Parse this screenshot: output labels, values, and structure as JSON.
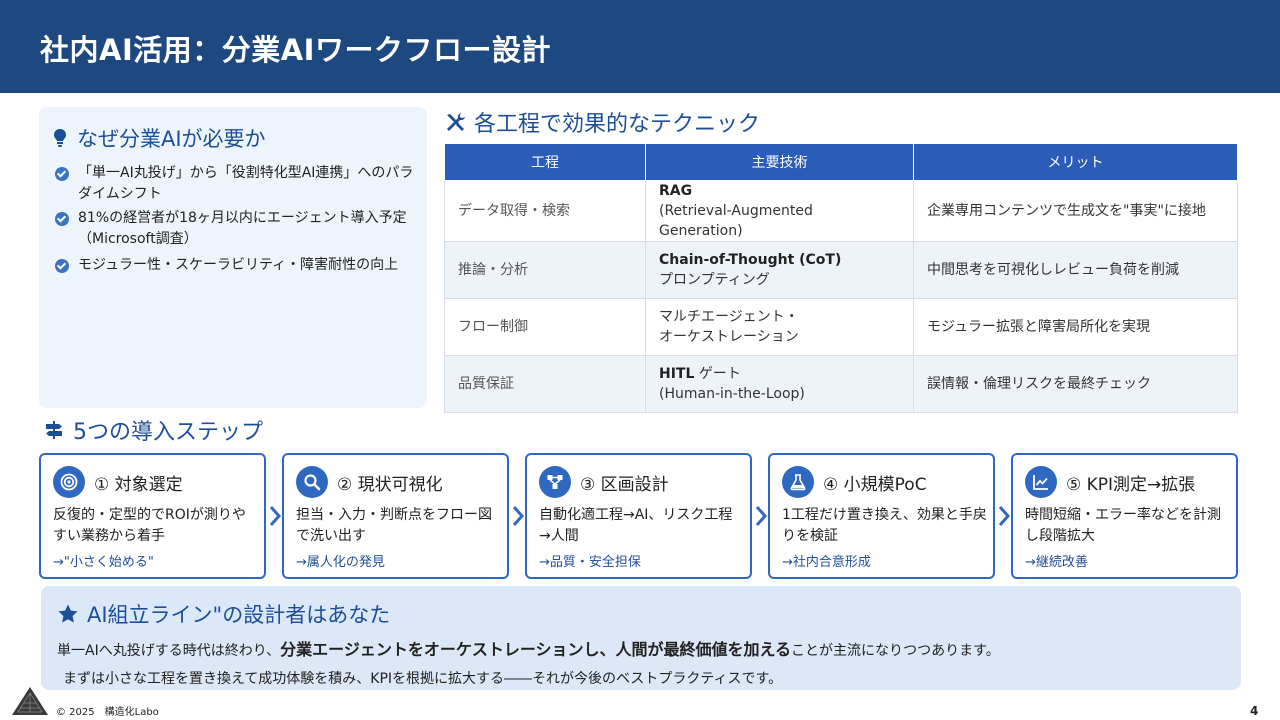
{
  "title": "社内AI活用：分業AIワークフロー設計",
  "why": {
    "title": "なぜ分業AIが必要か",
    "items": [
      "「単一AI丸投げ」から「役割特化型AI連携」へのパラダイムシフト",
      "81%の経営者が18ヶ月以内にエージェント導入予定（Microsoft調査）",
      "モジュラー性・スケーラビリティ・障害耐性の向上"
    ]
  },
  "techniques": {
    "title": "各工程で効果的なテクニック",
    "headers": [
      "工程",
      "主要技術",
      "メリット"
    ],
    "rows": [
      {
        "stage": "データ取得・検索",
        "tech_main": "RAG",
        "tech_sub": "(Retrieval-Augmented Generation)",
        "merit": "企業専用コンテンツで生成文を\"事実\"に接地"
      },
      {
        "stage": "推論・分析",
        "tech_main": "Chain-of-Thought (CoT)",
        "tech_sub": "プロンプティング",
        "merit": "中間思考を可視化しレビュー負荷を削減"
      },
      {
        "stage": "フロー制御",
        "tech_main": "マルチエージェント・",
        "tech_sub": "オーケストレーション",
        "merit": "モジュラー拡張と障害局所化を実現"
      },
      {
        "stage": "品質保証",
        "tech_main": "HITL",
        "tech_main_suffix": "ゲート",
        "tech_sub": "(Human-in-the-Loop)",
        "merit": "誤情報・倫理リスクを最終チェック"
      }
    ]
  },
  "steps": {
    "title": "5つの導入ステップ",
    "items": [
      {
        "name": "① 対象選定",
        "desc": "反復的・定型的でROIが測りやすい業務から着手",
        "result": "→\"小さく始める\"",
        "icon": "target-icon"
      },
      {
        "name": "② 現状可視化",
        "desc": "担当・入力・判断点をフロー図で洗い出す",
        "result": "→属人化の発見",
        "icon": "search-icon"
      },
      {
        "name": "③ 区画設計",
        "desc": "自動化適工程→AI、リスク工程→人間",
        "result": "→品質・安全担保",
        "icon": "network-icon"
      },
      {
        "name": "④ 小規模PoC",
        "desc": "1工程だけ置き換え、効果と手戻りを検証",
        "result": "→社内合意形成",
        "icon": "flask-icon"
      },
      {
        "name": "⑤ KPI測定→拡張",
        "desc": "時間短縮・エラー率などを計測し段階拡大",
        "result": "→継続改善",
        "icon": "chart-line-icon"
      }
    ]
  },
  "closing": {
    "title": "AI組立ライン\"の設計者はあなた",
    "line1_pre": "単一AIへ丸投げする時代は終わり、",
    "line1_em": "分業エージェントをオーケストレーションし、人間が最終価値を加える",
    "line1_post": "ことが主流になりつつあります。",
    "line2": "まずは小さな工程を置き換えて成功体験を積み、KPIを根拠に拡大する――それが今後のベストプラクティスです。"
  },
  "footer": {
    "copyright": "© 2025　構造化Labo",
    "page": "4"
  },
  "colors": {
    "header_bg": "#1d4880",
    "accent": "#2f68c0",
    "table_header": "#2b5cb8",
    "panel_bg": "#eef4fb",
    "closing_bg": "#dce8f7"
  }
}
